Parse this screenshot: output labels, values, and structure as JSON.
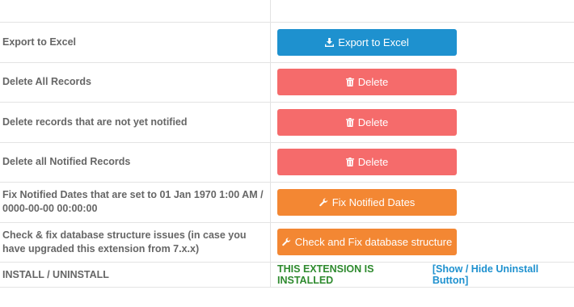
{
  "rows": [
    {
      "label": "Export to Excel",
      "button": "Export to Excel",
      "icon": "download-icon",
      "color": "#1e91cf"
    },
    {
      "label": "Delete All Records",
      "button": "Delete",
      "icon": "trash-icon",
      "color": "#f56b6b"
    },
    {
      "label": "Delete records that are not yet notified",
      "button": "Delete",
      "icon": "trash-icon",
      "color": "#f56b6b"
    },
    {
      "label": "Delete all Notified Records",
      "button": "Delete",
      "icon": "trash-icon",
      "color": "#f56b6b"
    },
    {
      "label": "Fix Notified Dates that are set to 01 Jan 1970 1:00 AM / 0000-00-00 00:00:00",
      "button": "Fix Notified Dates",
      "icon": "wrench-icon",
      "color": "#f38733"
    },
    {
      "label": "Check & fix database structure issues (in case you have upgraded this extension from 7.x.x)",
      "button": "Check and Fix database structure",
      "icon": "wrench-icon",
      "color": "#f38733"
    }
  ],
  "install": {
    "label": "INSTALL / UNINSTALL",
    "status": "THIS EXTENSION IS INSTALLED",
    "status_color": "#2e8a2e",
    "toggle_link": "[Show / Hide Uninstall Button]"
  }
}
